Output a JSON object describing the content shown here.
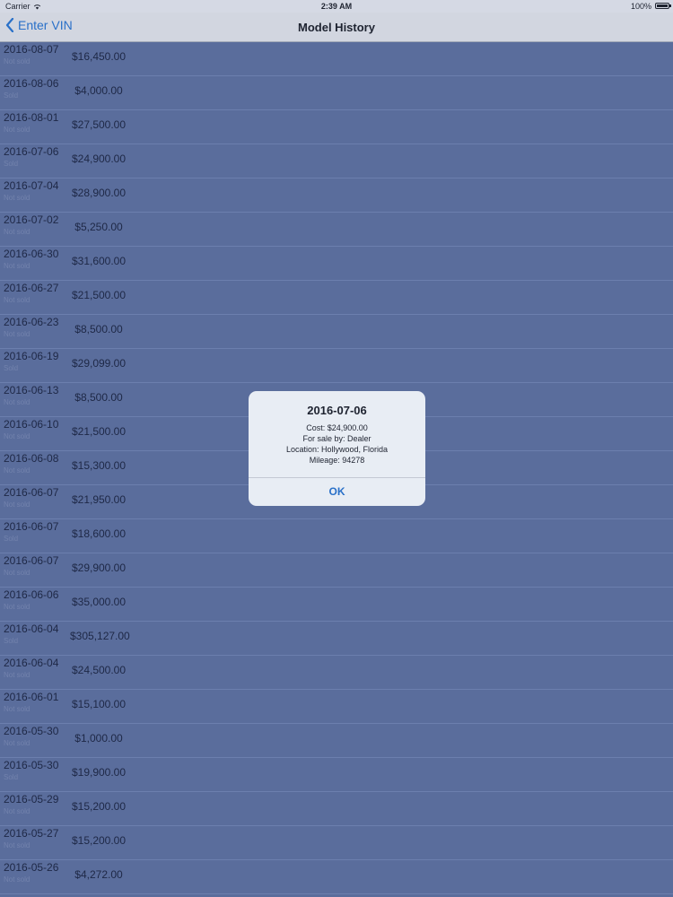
{
  "status_bar": {
    "carrier": "Carrier",
    "time": "2:39 AM",
    "battery": "100%"
  },
  "nav": {
    "back_label": "Enter VIN",
    "title": "Model History"
  },
  "rows": [
    {
      "date": "2016-08-07",
      "status": "Not sold",
      "price": "$16,450.00"
    },
    {
      "date": "2016-08-06",
      "status": "Sold",
      "price": "$4,000.00"
    },
    {
      "date": "2016-08-01",
      "status": "Not sold",
      "price": "$27,500.00"
    },
    {
      "date": "2016-07-06",
      "status": "Sold",
      "price": "$24,900.00"
    },
    {
      "date": "2016-07-04",
      "status": "Not sold",
      "price": "$28,900.00"
    },
    {
      "date": "2016-07-02",
      "status": "Not sold",
      "price": "$5,250.00"
    },
    {
      "date": "2016-06-30",
      "status": "Not sold",
      "price": "$31,600.00"
    },
    {
      "date": "2016-06-27",
      "status": "Not sold",
      "price": "$21,500.00"
    },
    {
      "date": "2016-06-23",
      "status": "Not sold",
      "price": "$8,500.00"
    },
    {
      "date": "2016-06-19",
      "status": "Sold",
      "price": "$29,099.00"
    },
    {
      "date": "2016-06-13",
      "status": "Not sold",
      "price": "$8,500.00"
    },
    {
      "date": "2016-06-10",
      "status": "Not sold",
      "price": "$21,500.00"
    },
    {
      "date": "2016-06-08",
      "status": "Not sold",
      "price": "$15,300.00"
    },
    {
      "date": "2016-06-07",
      "status": "Not sold",
      "price": "$21,950.00"
    },
    {
      "date": "2016-06-07",
      "status": "Sold",
      "price": "$18,600.00"
    },
    {
      "date": "2016-06-07",
      "status": "Not sold",
      "price": "$29,900.00"
    },
    {
      "date": "2016-06-06",
      "status": "Not sold",
      "price": "$35,000.00"
    },
    {
      "date": "2016-06-04",
      "status": "Sold",
      "price": "$305,127.00"
    },
    {
      "date": "2016-06-04",
      "status": "Not sold",
      "price": "$24,500.00"
    },
    {
      "date": "2016-06-01",
      "status": "Not sold",
      "price": "$15,100.00"
    },
    {
      "date": "2016-05-30",
      "status": "Not sold",
      "price": "$1,000.00"
    },
    {
      "date": "2016-05-30",
      "status": "Sold",
      "price": "$19,900.00"
    },
    {
      "date": "2016-05-29",
      "status": "Not sold",
      "price": "$15,200.00"
    },
    {
      "date": "2016-05-27",
      "status": "Not sold",
      "price": "$15,200.00"
    },
    {
      "date": "2016-05-26",
      "status": "Not sold",
      "price": "$4,272.00"
    }
  ],
  "alert": {
    "title": "2016-07-06",
    "cost": "Cost: $24,900.00",
    "seller": "For sale by: Dealer",
    "location": "Location: Hollywood, Florida",
    "mileage": "Mileage: 94278",
    "ok_label": "OK"
  },
  "colors": {
    "accent": "#2970c8",
    "dim_background": "#5a6d9c",
    "alert_background": "#e8edf4"
  },
  "icons": {
    "back": "chevron-left-icon",
    "wifi": "wifi-icon",
    "battery": "battery-icon"
  }
}
